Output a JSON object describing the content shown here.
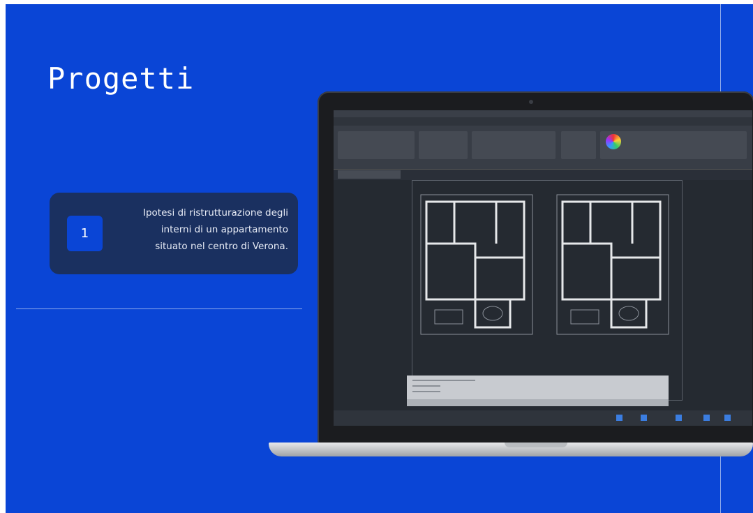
{
  "slide": {
    "title": "Progetti",
    "background_color": "#0a45d6"
  },
  "project_card": {
    "number": "1",
    "description": "Ipotesi di ristrutturazione degli\ninterni di un appartamento\nsituato nel centro di Verona."
  },
  "laptop_image": {
    "icon": "laptop-cad-screenshot"
  }
}
